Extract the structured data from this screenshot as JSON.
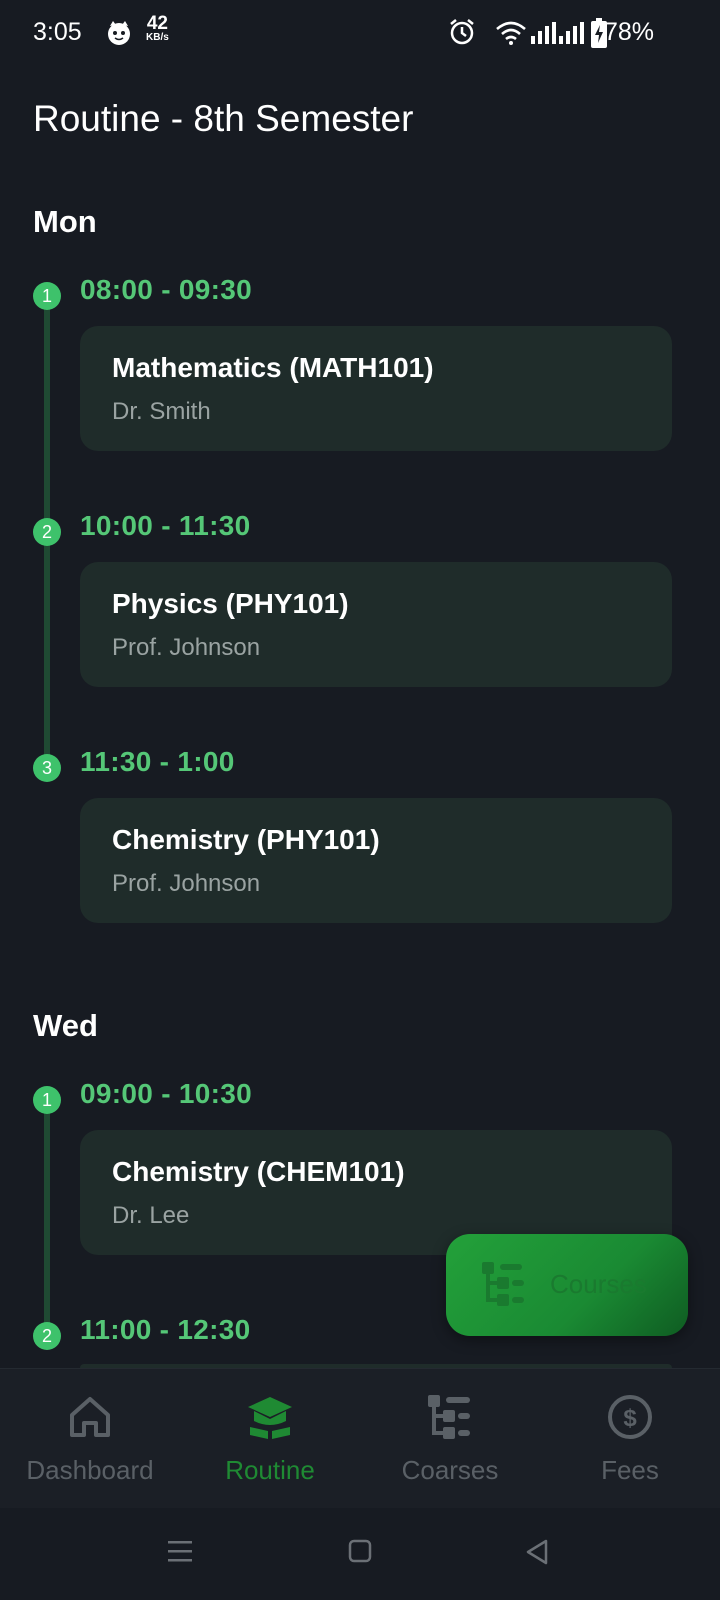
{
  "status_bar": {
    "time": "3:05",
    "net_speed_value": "42",
    "net_speed_unit": "KB/s",
    "battery": "78%"
  },
  "page": {
    "title": "Routine - 8th Semester"
  },
  "days": [
    {
      "name": "Mon",
      "classes": [
        {
          "index": "1",
          "time": "08:00 - 09:30",
          "subject": "Mathematics (MATH101)",
          "teacher": "Dr. Smith"
        },
        {
          "index": "2",
          "time": "10:00 - 11:30",
          "subject": "Physics (PHY101)",
          "teacher": "Prof. Johnson"
        },
        {
          "index": "3",
          "time": "11:30 - 1:00",
          "subject": "Chemistry (PHY101)",
          "teacher": "Prof. Johnson"
        }
      ]
    },
    {
      "name": "Wed",
      "classes": [
        {
          "index": "1",
          "time": "09:00 - 10:30",
          "subject": "Chemistry (CHEM101)",
          "teacher": "Dr. Lee"
        },
        {
          "index": "2",
          "time": "11:00 - 12:30"
        }
      ]
    }
  ],
  "fab": {
    "label": "Courses",
    "icon": "courses-tree-icon"
  },
  "bottom_nav": {
    "active": "Routine",
    "items": [
      {
        "label": "Dashboard",
        "icon": "home-icon"
      },
      {
        "label": "Routine",
        "icon": "graduation-cap-icon"
      },
      {
        "label": "Coarses",
        "icon": "courses-tree-icon"
      },
      {
        "label": "Fees",
        "icon": "dollar-circle-icon"
      }
    ]
  },
  "colors": {
    "background": "#171b22",
    "accent_green": "#55c777",
    "card": "#1f2c2a",
    "active_nav": "#1f8a33"
  }
}
